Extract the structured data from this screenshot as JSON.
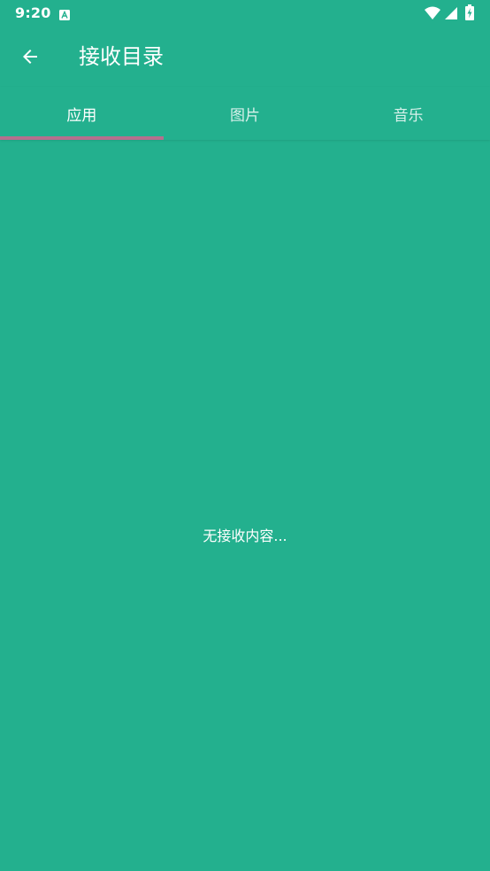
{
  "status_bar": {
    "time": "9:20",
    "notification_icon": "a-letter-icon",
    "wifi_icon": "wifi-icon",
    "signal_icon": "signal-icon",
    "battery_icon": "battery-charging-icon"
  },
  "app_bar": {
    "back_icon": "arrow-left-icon",
    "title": "接收目录"
  },
  "tabs": [
    {
      "label": "应用",
      "selected": true
    },
    {
      "label": "图片",
      "selected": false
    },
    {
      "label": "音乐",
      "selected": false
    }
  ],
  "content": {
    "empty_message": "无接收内容..."
  },
  "colors": {
    "background": "#23B08E",
    "tab_indicator": "#B5708E",
    "text": "#FFFFFF"
  }
}
